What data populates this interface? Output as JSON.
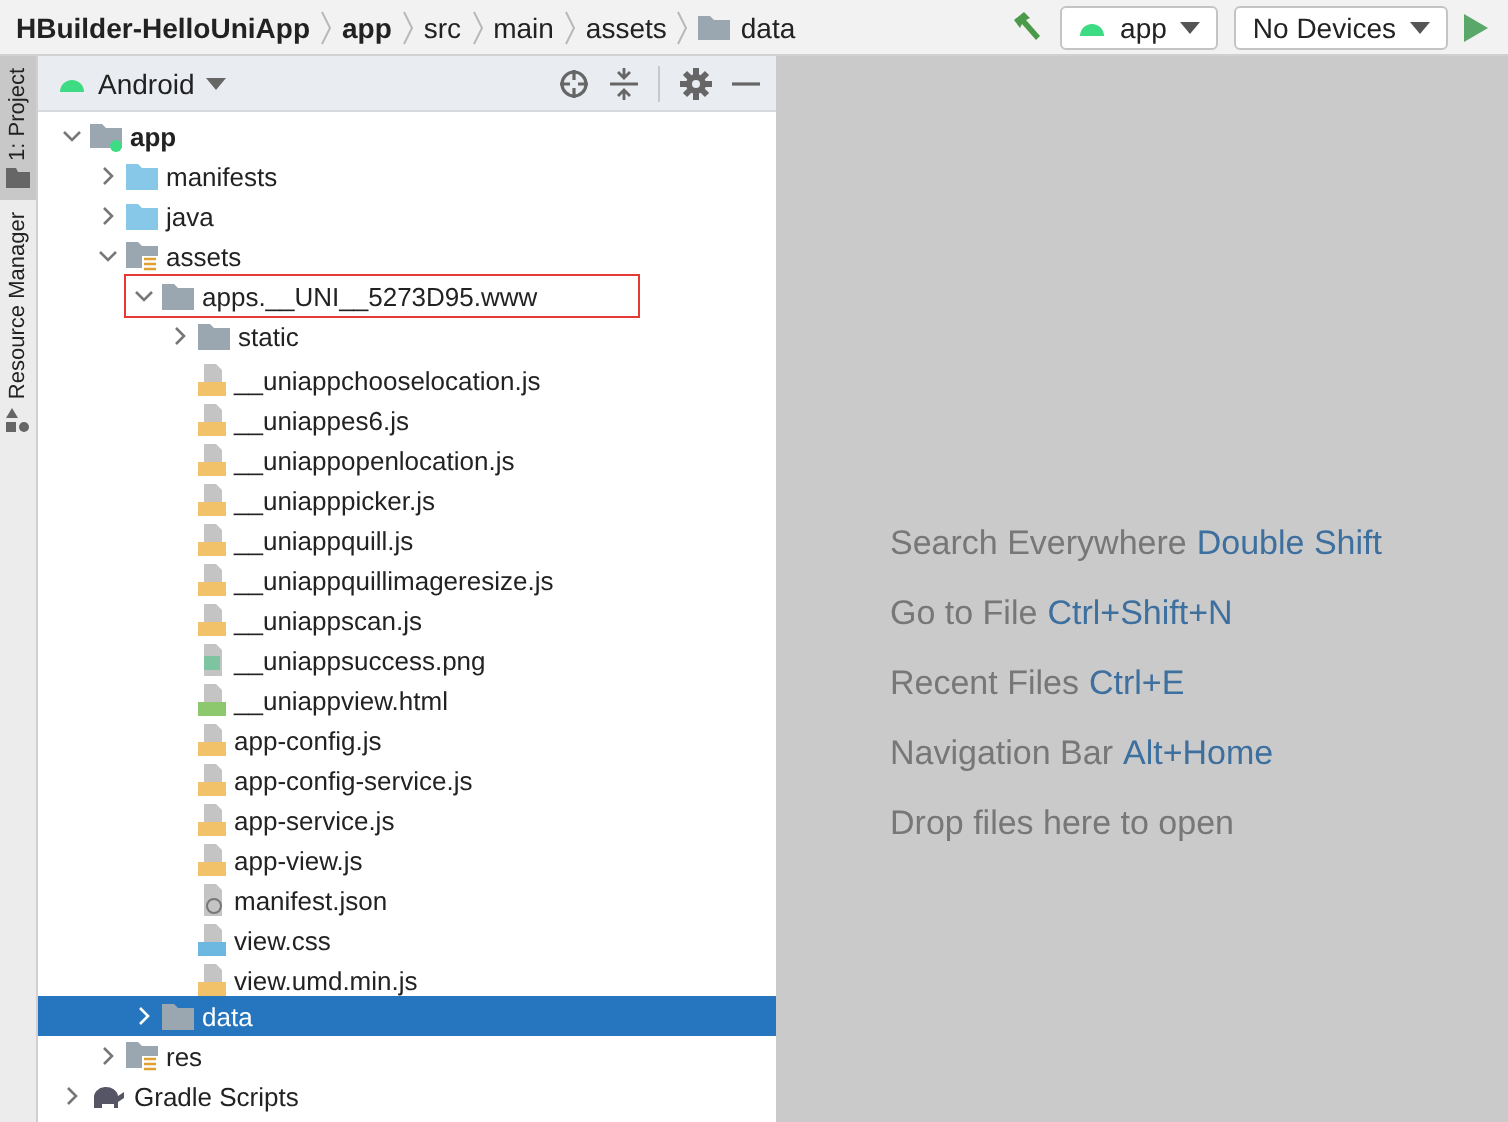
{
  "breadcrumb": [
    {
      "label": "HBuilder-HelloUniApp",
      "bold": true,
      "kind": "project"
    },
    {
      "label": "app",
      "bold": true,
      "kind": "module"
    },
    {
      "label": "src",
      "bold": false,
      "kind": "dir"
    },
    {
      "label": "main",
      "bold": false,
      "kind": "dir"
    },
    {
      "label": "assets",
      "bold": false,
      "kind": "dir"
    },
    {
      "label": "data",
      "bold": false,
      "kind": "folder"
    }
  ],
  "toolbar": {
    "config": "app",
    "device": "No Devices"
  },
  "side_tabs": [
    {
      "label": "1: Project",
      "selected": true
    },
    {
      "label": "Resource Manager",
      "selected": false
    }
  ],
  "panel": {
    "view": "Android"
  },
  "tree": [
    {
      "name": "app",
      "kind": "module",
      "expanded": true,
      "selected": false,
      "outlined": false,
      "children": [
        {
          "name": "manifests",
          "kind": "source",
          "expanded": false,
          "selected": false,
          "outlined": false
        },
        {
          "name": "java",
          "kind": "source",
          "expanded": false,
          "selected": false,
          "outlined": false
        },
        {
          "name": "assets",
          "kind": "resource",
          "expanded": true,
          "selected": false,
          "outlined": false,
          "children": [
            {
              "name": "apps.__UNI__5273D95.www",
              "kind": "folder",
              "expanded": true,
              "selected": false,
              "outlined": true,
              "children": [
                {
                  "name": "static",
                  "kind": "folder",
                  "expanded": false,
                  "selected": false,
                  "outlined": false
                },
                {
                  "name": "__uniappchooselocation.js",
                  "kind": "js",
                  "selected": false,
                  "outlined": false
                },
                {
                  "name": "__uniappes6.js",
                  "kind": "js",
                  "selected": false,
                  "outlined": false
                },
                {
                  "name": "__uniappopenlocation.js",
                  "kind": "js",
                  "selected": false,
                  "outlined": false
                },
                {
                  "name": "__uniapppicker.js",
                  "kind": "js",
                  "selected": false,
                  "outlined": false
                },
                {
                  "name": "__uniappquill.js",
                  "kind": "js",
                  "selected": false,
                  "outlined": false
                },
                {
                  "name": "__uniappquillimageresize.js",
                  "kind": "js",
                  "selected": false,
                  "outlined": false
                },
                {
                  "name": "__uniappscan.js",
                  "kind": "js",
                  "selected": false,
                  "outlined": false
                },
                {
                  "name": "__uniappsuccess.png",
                  "kind": "image",
                  "selected": false,
                  "outlined": false
                },
                {
                  "name": "__uniappview.html",
                  "kind": "html",
                  "selected": false,
                  "outlined": false
                },
                {
                  "name": "app-config.js",
                  "kind": "js",
                  "selected": false,
                  "outlined": false
                },
                {
                  "name": "app-config-service.js",
                  "kind": "js",
                  "selected": false,
                  "outlined": false
                },
                {
                  "name": "app-service.js",
                  "kind": "js",
                  "selected": false,
                  "outlined": false
                },
                {
                  "name": "app-view.js",
                  "kind": "js",
                  "selected": false,
                  "outlined": false
                },
                {
                  "name": "manifest.json",
                  "kind": "json",
                  "selected": false,
                  "outlined": false
                },
                {
                  "name": "view.css",
                  "kind": "css",
                  "selected": false,
                  "outlined": false
                },
                {
                  "name": "view.umd.min.js",
                  "kind": "js",
                  "selected": false,
                  "outlined": false
                }
              ]
            },
            {
              "name": "data",
              "kind": "folder",
              "expanded": false,
              "selected": true,
              "outlined": false
            }
          ]
        },
        {
          "name": "res",
          "kind": "resource",
          "expanded": false,
          "selected": false,
          "outlined": false
        }
      ]
    },
    {
      "name": "Gradle Scripts",
      "kind": "gradle",
      "expanded": false,
      "selected": false,
      "outlined": false
    }
  ],
  "hints": [
    {
      "text": "Search Everywhere",
      "shortcut": "Double Shift"
    },
    {
      "text": "Go to File",
      "shortcut": "Ctrl+Shift+N"
    },
    {
      "text": "Recent Files",
      "shortcut": "Ctrl+E"
    },
    {
      "text": "Navigation Bar",
      "shortcut": "Alt+Home"
    },
    {
      "text": "Drop files here to open"
    }
  ]
}
